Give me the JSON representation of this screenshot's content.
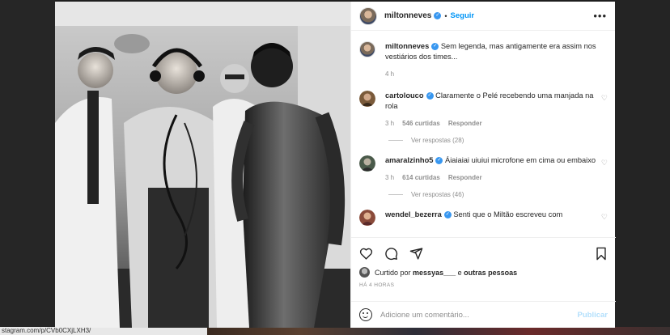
{
  "post": {
    "username": "miltonneves",
    "follow_label": "Seguir",
    "separator": "•",
    "more_icon": "•••"
  },
  "caption": {
    "username": "miltonneves",
    "text": "Sem legenda, mas antigamente era assim nos vestiários dos times...",
    "time": "4 h"
  },
  "comments": [
    {
      "username": "cartolouco",
      "text": "Claramente o Pelé recebendo uma manjada na rola",
      "time": "3 h",
      "likes": "546 curtidas",
      "reply_label": "Responder",
      "view_replies": "Ver respostas (28)"
    },
    {
      "username": "amaralzinho5",
      "text": "Áiaiaiai uiuiui microfone em cima ou embaixo",
      "time": "3 h",
      "likes": "614 curtidas",
      "reply_label": "Responder",
      "view_replies": "Ver respostas (46)"
    },
    {
      "username": "wendel_bezerra",
      "text": "Senti que o Miltão escreveu com"
    }
  ],
  "likes_line": {
    "prefix": "Curtido por",
    "user": "messyas___",
    "conj": "e",
    "others": "outras pessoas"
  },
  "posted_ago": "HÁ 4 HORAS",
  "comment_box": {
    "placeholder": "Adicione um comentário...",
    "publish_label": "Publicar"
  },
  "status_url": "stagram.com/p/CVb0CXjLXH3/",
  "colors": {
    "accent": "#0095f6",
    "verified": "#3897f0",
    "muted": "#8e8e8e",
    "publish_disabled": "#b2dffc"
  },
  "icons": [
    "heart-icon",
    "comment-icon",
    "share-icon",
    "bookmark-icon",
    "emoji-icon",
    "verified-icon",
    "more-icon"
  ]
}
